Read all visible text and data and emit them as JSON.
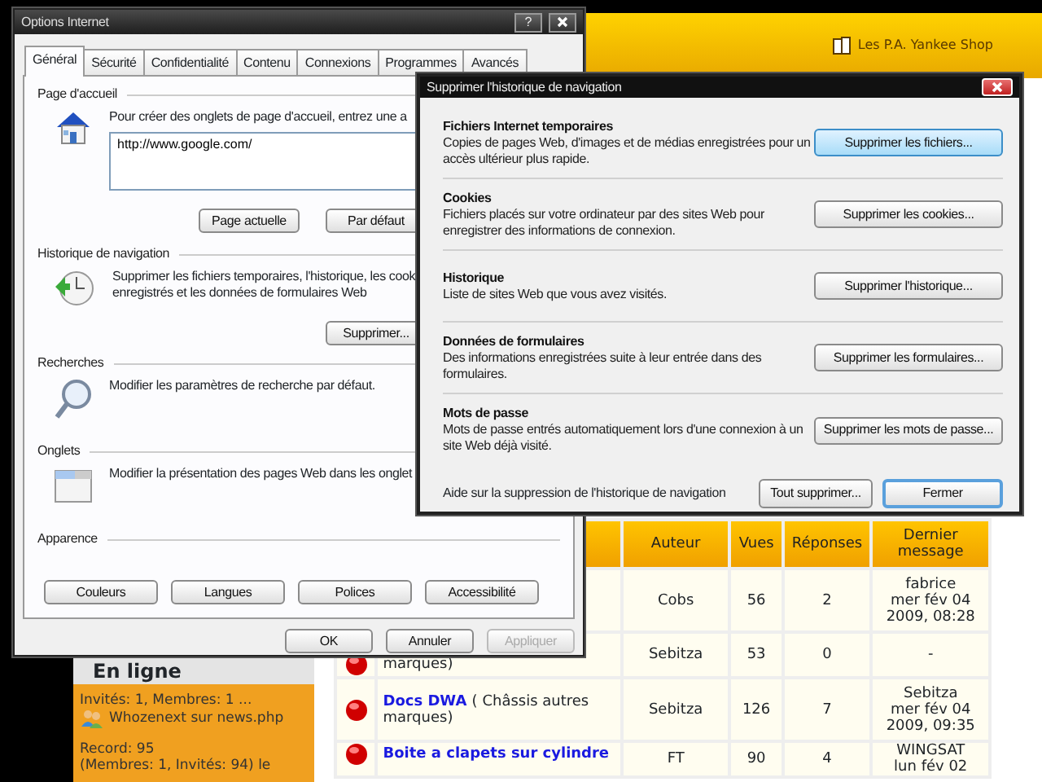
{
  "web_page": {
    "header_link": "Les P.A. Yankee Shop",
    "sidebar": {
      "title": "En ligne",
      "lines": [
        {
          "kind": "text",
          "text": "Invités: 1, Membres: 1 ..."
        },
        {
          "kind": "user",
          "name": "Whozenext",
          "joiner": "sur",
          "page": "news.php"
        },
        {
          "kind": "gap"
        },
        {
          "kind": "text",
          "text": "Record: 95"
        },
        {
          "kind": "text",
          "text": "(Membres: 1, Invités: 94) le"
        }
      ]
    },
    "table": {
      "columns": [
        "Auteur",
        "Vues",
        "Réponses",
        "Dernier message"
      ],
      "rows": [
        {
          "topic": [],
          "author": "Cobs",
          "views": "56",
          "replies": "2",
          "last_post": {
            "user": "fabrice",
            "lines": [
              "mer fév 04",
              "2009, 08:28"
            ]
          }
        },
        {
          "topic": [
            {
              "kind": "category",
              "text": "marques"
            },
            {
              "kind": "plain",
              "text": ")"
            }
          ],
          "author": "Sebitza",
          "views": "53",
          "replies": "0",
          "last_post": {
            "lines": [
              "-"
            ]
          }
        },
        {
          "topic": [
            {
              "kind": "title",
              "text": "Docs DWA"
            },
            {
              "kind": "plain",
              "text": "("
            },
            {
              "kind": "category",
              "text": "Châssis autres"
            },
            {
              "kind": "category",
              "text": "marques"
            },
            {
              "kind": "plain",
              "text": ")"
            }
          ],
          "author": "Sebitza",
          "views": "126",
          "replies": "7",
          "last_post": {
            "user": "Sebitza",
            "lines": [
              "mer fév 04",
              "2009, 09:35"
            ]
          }
        },
        {
          "topic": [
            {
              "kind": "title",
              "text": "Boite a clapets sur cylindre"
            }
          ],
          "author": "FT",
          "views": "90",
          "replies": "4",
          "last_post": {
            "user": "WINGSAT",
            "lines": [
              "lun fév 02"
            ]
          }
        }
      ]
    }
  },
  "options_dialog": {
    "title": "Options Internet",
    "help": "?",
    "tabs": [
      {
        "label": "Général",
        "selected": true
      },
      {
        "label": "Sécurité",
        "selected": false
      },
      {
        "label": "Confidentialité",
        "selected": false
      },
      {
        "label": "Contenu",
        "selected": false
      },
      {
        "label": "Connexions",
        "selected": false
      },
      {
        "label": "Programmes",
        "selected": false
      },
      {
        "label": "Avancés",
        "selected": false
      }
    ],
    "sections": [
      {
        "kind": "home",
        "heading": "Page d'accueil",
        "lines": [
          "Pour créer des onglets de page d'accueil, entrez une a"
        ],
        "url": "http://www.google.com/",
        "buttons": [
          "Page actuelle",
          "Par défaut"
        ]
      },
      {
        "kind": "history",
        "heading": "Historique de navigation",
        "lines": [
          "Supprimer les fichiers temporaires, l'historique, les cook",
          "enregistrés et les données de formulaires Web"
        ],
        "buttons": [
          "Supprimer..."
        ]
      },
      {
        "kind": "search",
        "heading": "Recherches",
        "lines": [
          "Modifier les paramètres de recherche par défaut."
        ]
      },
      {
        "kind": "tabs",
        "heading": "Onglets",
        "lines": [
          "Modifier la présentation des pages Web dans les onglet"
        ]
      },
      {
        "kind": "appearance",
        "heading": "Apparence",
        "buttons": [
          "Couleurs",
          "Langues",
          "Polices",
          "Accessibilité"
        ]
      }
    ],
    "footer_buttons": [
      {
        "label": "OK",
        "disabled": false
      },
      {
        "label": "Annuler",
        "disabled": false
      },
      {
        "label": "Appliquer",
        "disabled": true
      }
    ]
  },
  "delete_dialog": {
    "title": "Supprimer l'historique de navigation",
    "sections": [
      {
        "heading": "Fichiers Internet temporaires",
        "text": "Copies de pages Web, d'images et de médias enregistrées pour un accès ultérieur plus rapide.",
        "button": "Supprimer les fichiers...",
        "focused": true
      },
      {
        "heading": "Cookies",
        "text": "Fichiers placés sur votre ordinateur par des sites Web pour enregistrer des informations de connexion.",
        "button": "Supprimer les cookies...",
        "focused": false
      },
      {
        "heading": "Historique",
        "text": "Liste de sites Web que vous avez visités.",
        "button": "Supprimer l'historique...",
        "focused": false
      },
      {
        "heading": "Données de formulaires",
        "text": "Des informations enregistrées suite à leur entrée dans des formulaires.",
        "button": "Supprimer les formulaires...",
        "focused": false
      },
      {
        "heading": "Mots de passe",
        "text": "Mots de passe entrés automatiquement lors d'une connexion à un site Web déjà visité.",
        "button": "Supprimer les mots de passe...",
        "focused": false
      }
    ],
    "help_link": "Aide sur la suppression de l'historique de navigation",
    "buttons": [
      {
        "label": "Tout supprimer...",
        "default": false
      },
      {
        "label": "Fermer",
        "default": true
      }
    ]
  }
}
